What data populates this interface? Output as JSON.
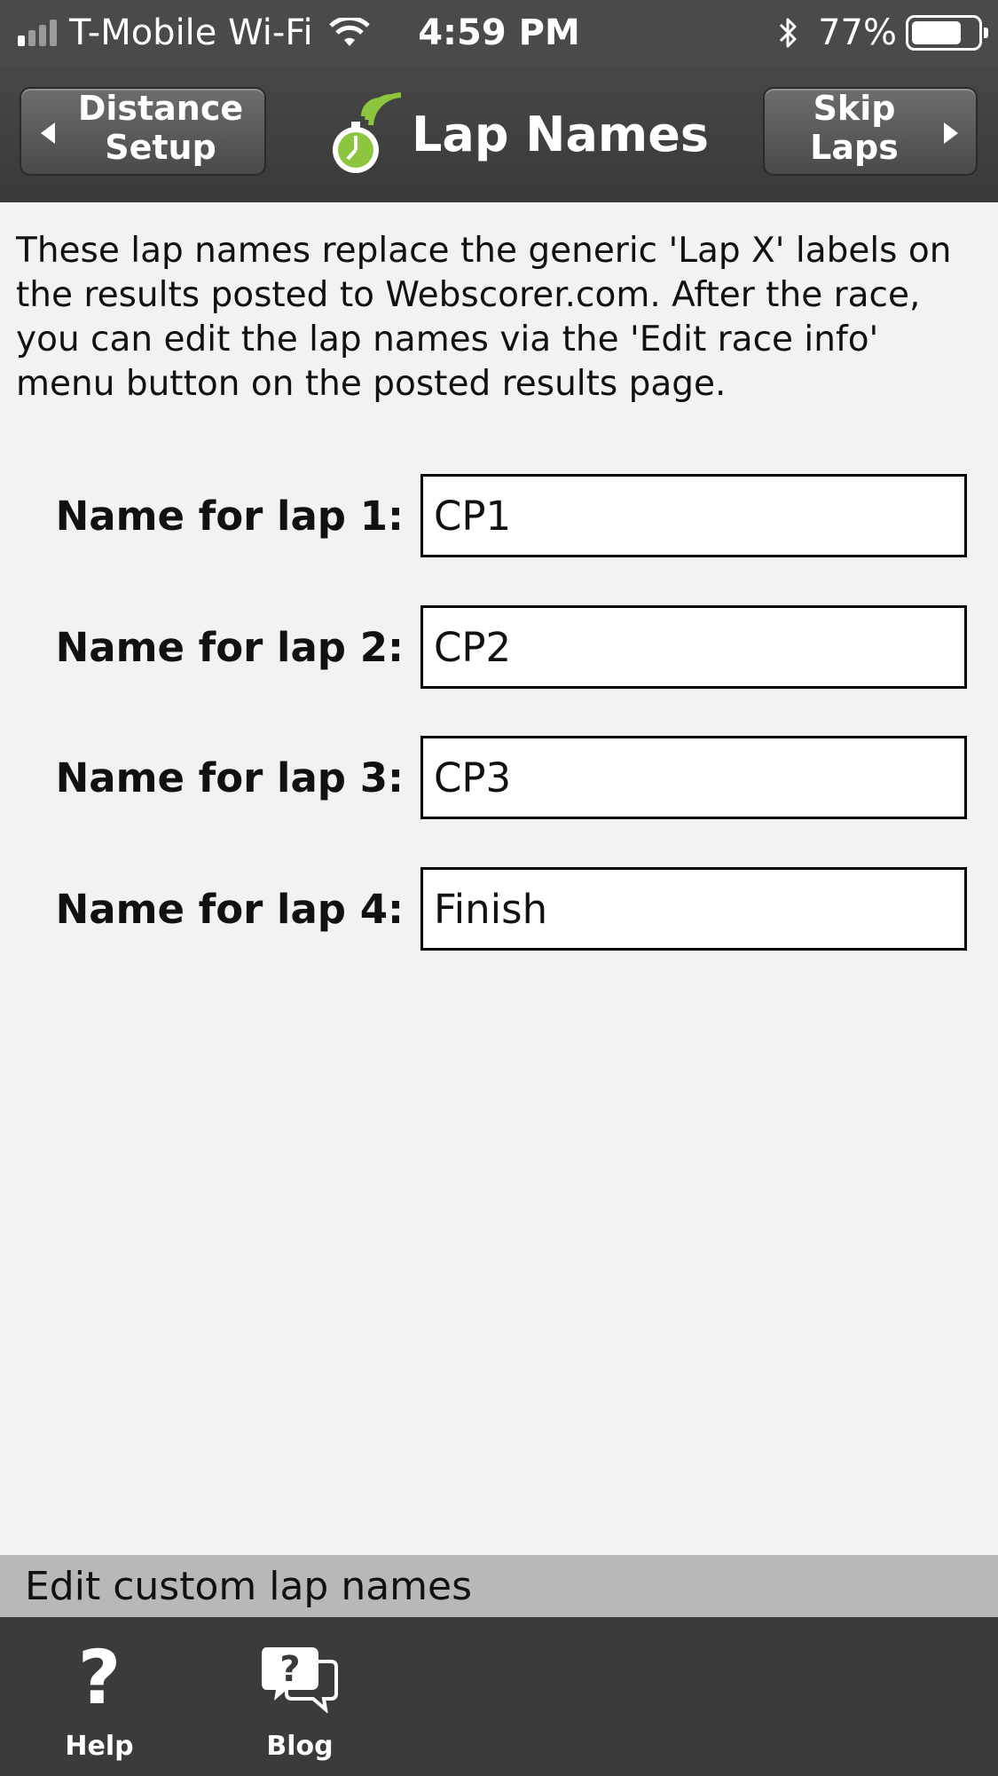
{
  "status_bar": {
    "carrier": "T-Mobile Wi-Fi",
    "time": "4:59 PM",
    "battery_percent": "77%",
    "battery_level": 0.77,
    "signal_bars": 1
  },
  "nav": {
    "back_line1": "Distance",
    "back_line2": "Setup",
    "title": "Lap Names",
    "forward_line1": "Skip",
    "forward_line2": "Laps"
  },
  "description": "These lap names replace the generic 'Lap X' labels on the results posted to Webscorer.com. After the race, you can edit the lap names via the 'Edit race info' menu button on the posted results page.",
  "laps": [
    {
      "label": "Name for lap 1:",
      "value": "CP1"
    },
    {
      "label": "Name for lap 2:",
      "value": "CP2"
    },
    {
      "label": "Name for lap 3:",
      "value": "CP3"
    },
    {
      "label": "Name for lap 4:",
      "value": "Finish"
    }
  ],
  "footer_label": "Edit custom lap names",
  "tabs": {
    "help": "Help",
    "blog": "Blog",
    "help_glyph": "?"
  },
  "colors": {
    "brand_green": "#8cc63f",
    "nav_bg": "#3a3a3a",
    "footer_label_bg": "#b8b8b8"
  }
}
